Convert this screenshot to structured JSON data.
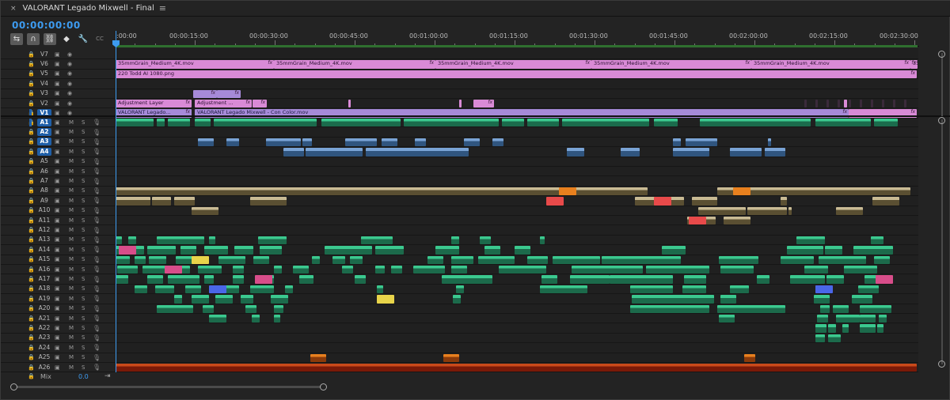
{
  "window": {
    "close_glyph": "×",
    "title": "VALORANT Legado Mixwell - Final",
    "menu_glyph": "≡"
  },
  "timecode": "00:00:00:00",
  "toolbar": {
    "tools": [
      {
        "name": "insert-overwrite-icon",
        "glyph": "⇆",
        "active": true
      },
      {
        "name": "snap-magnet-icon",
        "glyph": "∩",
        "active": true
      },
      {
        "name": "linked-selection-icon",
        "glyph": "⛓",
        "active": true
      },
      {
        "name": "add-marker-icon",
        "glyph": "◆",
        "active": false
      },
      {
        "name": "wrench-settings-icon",
        "glyph": "🔧",
        "active": false
      },
      {
        "name": "captions-icon",
        "glyph": "CC",
        "active": false
      }
    ]
  },
  "ruler": {
    "labels": [
      ":00:00",
      "00:00:15:00",
      "00:00:30:00",
      "00:00:45:00",
      "00:01:00:00",
      "00:01:15:00",
      "00:01:30:00",
      "00:01:45:00",
      "00:02:00:00",
      "00:02:15:00",
      "00:02:30:00"
    ]
  },
  "video_tracks": [
    {
      "name": "V7",
      "target": false
    },
    {
      "name": "V6",
      "target": false
    },
    {
      "name": "V5",
      "target": false
    },
    {
      "name": "V4",
      "target": false
    },
    {
      "name": "V3",
      "target": false
    },
    {
      "name": "V2",
      "target": false
    },
    {
      "name": "V1",
      "target": true
    }
  ],
  "audio_tracks": [
    {
      "name": "A1",
      "target": true
    },
    {
      "name": "A2",
      "target": true
    },
    {
      "name": "A3",
      "target": true
    },
    {
      "name": "A4",
      "target": true
    },
    {
      "name": "A5",
      "target": false
    },
    {
      "name": "A6",
      "target": false
    },
    {
      "name": "A7",
      "target": false
    },
    {
      "name": "A8",
      "target": false
    },
    {
      "name": "A9",
      "target": false
    },
    {
      "name": "A10",
      "target": false
    },
    {
      "name": "A11",
      "target": false
    },
    {
      "name": "A12",
      "target": false
    },
    {
      "name": "A13",
      "target": false
    },
    {
      "name": "A14",
      "target": false
    },
    {
      "name": "A15",
      "target": false
    },
    {
      "name": "A16",
      "target": false
    },
    {
      "name": "A17",
      "target": false
    },
    {
      "name": "A18",
      "target": false
    },
    {
      "name": "A19",
      "target": false
    },
    {
      "name": "A20",
      "target": false
    },
    {
      "name": "A21",
      "target": false
    },
    {
      "name": "A22",
      "target": false
    },
    {
      "name": "A23",
      "target": false
    },
    {
      "name": "A24",
      "target": false
    },
    {
      "name": "A25",
      "target": false
    },
    {
      "name": "A26",
      "target": false
    }
  ],
  "audio_header": {
    "mute_label": "M",
    "solo_label": "S"
  },
  "video_clips": {
    "grain_label": "35mmGrain_Medium_4K.mov",
    "fx_label": "fx",
    "v5_label": "220 Todd AI 1080.png",
    "adjustment_label_1": "Adjustment Layer",
    "adjustment_label_2": "Adjustment ...",
    "v1_label_1": "VALORANT Legado...",
    "v1_label_2": "VALORANT Legado Mixwell - Con Color.mov"
  },
  "mix": {
    "label": "Mix",
    "value": "0.0"
  },
  "colors": {
    "accent": "#3d9bf0",
    "video_pink": "#d98ad6",
    "video_violet": "#a68ad9",
    "audio_green": "#3bc98f",
    "audio_blue": "#7aa4d6",
    "audio_tan": "#c9bb94",
    "audio_orange": "#e8801e"
  }
}
